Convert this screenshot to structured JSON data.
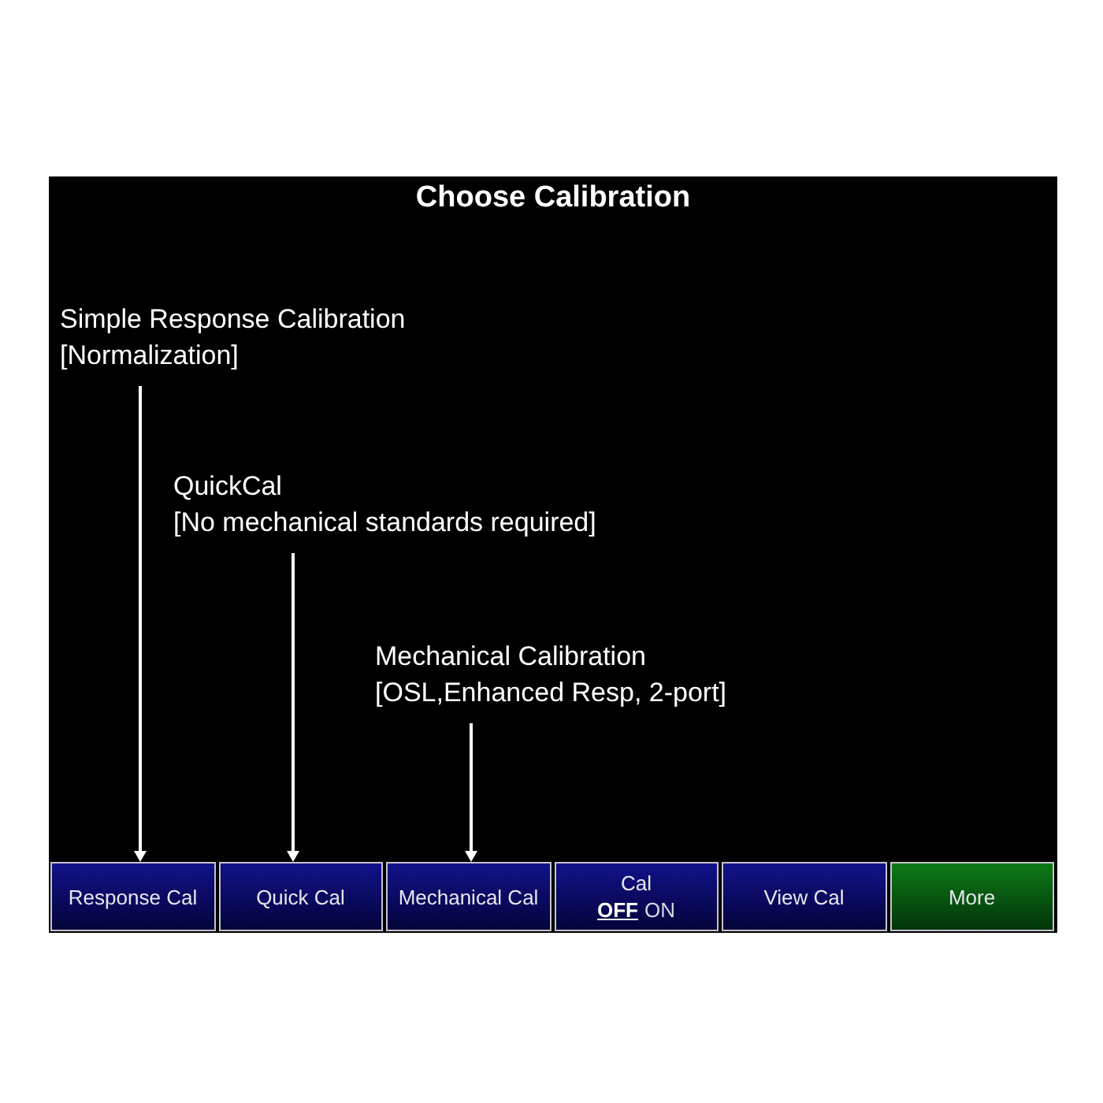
{
  "title": "Choose Calibration",
  "annotations": [
    {
      "heading": "Simple Response Calibration",
      "detail": "[Normalization]"
    },
    {
      "heading": "QuickCal",
      "detail": "[No mechanical standards required]"
    },
    {
      "heading": "Mechanical Calibration",
      "detail": "[OSL,Enhanced Resp, 2-port]"
    }
  ],
  "softkeys": [
    {
      "kind": "action",
      "label": "Response Cal"
    },
    {
      "kind": "action",
      "label": "Quick Cal"
    },
    {
      "kind": "action",
      "label": "Mechanical Cal"
    },
    {
      "kind": "toggle",
      "label": "Cal",
      "options": [
        {
          "label": "OFF",
          "selected": true
        },
        {
          "label": "ON",
          "selected": false
        }
      ]
    },
    {
      "kind": "action",
      "label": "View Cal"
    },
    {
      "kind": "menu",
      "label": "More"
    }
  ]
}
